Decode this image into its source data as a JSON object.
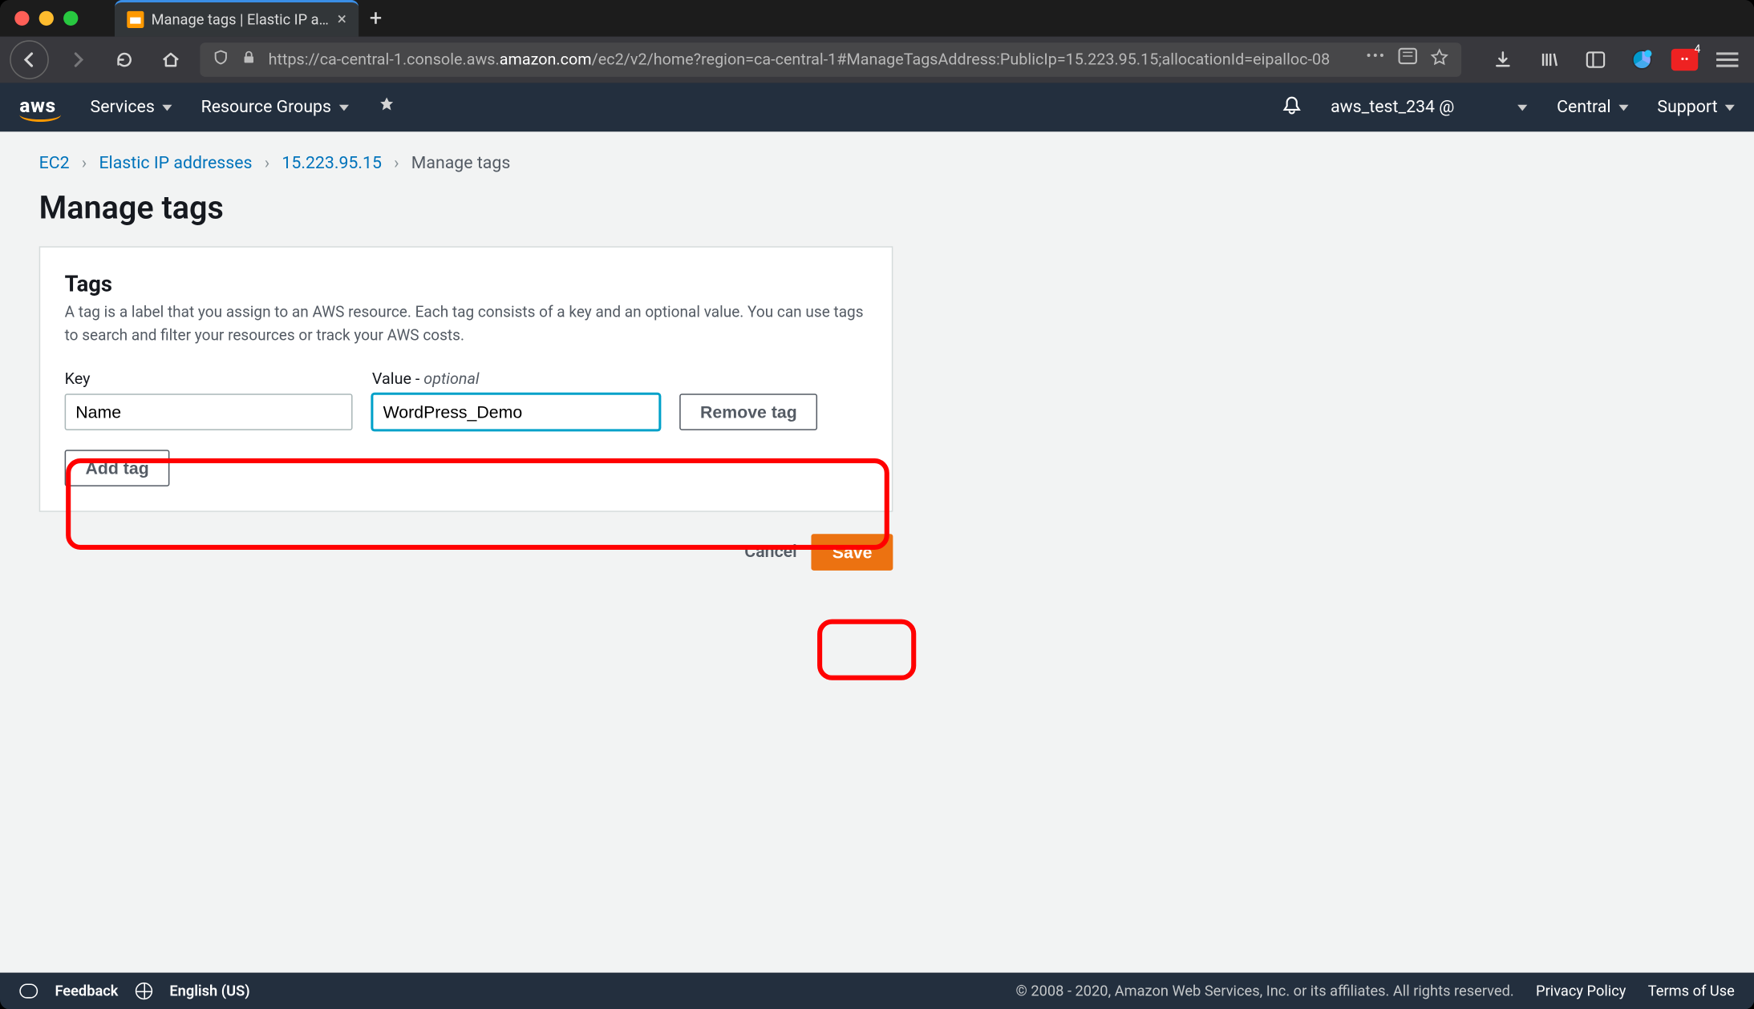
{
  "browser": {
    "tab_title": "Manage tags | Elastic IP addres",
    "url_prefix": "https://ca-central-1.console.aws.",
    "url_domain": "amazon.com",
    "url_suffix": "/ec2/v2/home?region=ca-central-1#ManageTagsAddress:PublicIp=15.223.95.15;allocationId=eipalloc-08",
    "badge_count": "4"
  },
  "header": {
    "services": "Services",
    "resource_groups": "Resource Groups",
    "account": "aws_test_234 @",
    "region": "Central",
    "support": "Support"
  },
  "breadcrumbs": {
    "ec2": "EC2",
    "eip": "Elastic IP addresses",
    "ip": "15.223.95.15",
    "current": "Manage tags"
  },
  "page": {
    "title": "Manage tags",
    "panel_title": "Tags",
    "panel_desc": "A tag is a label that you assign to an AWS resource. Each tag consists of a key and an optional value. You can use tags to search and filter your resources or track your AWS costs.",
    "key_label": "Key",
    "value_label_prefix": "Value - ",
    "value_label_opt": "optional",
    "remove_btn": "Remove tag",
    "add_btn": "Add tag",
    "cancel": "Cancel",
    "save": "Save",
    "tag_key": "Name",
    "tag_value": "WordPress_Demo"
  },
  "footer": {
    "feedback": "Feedback",
    "language": "English (US)",
    "copyright": "© 2008 - 2020, Amazon Web Services, Inc. or its affiliates. All rights reserved.",
    "privacy": "Privacy Policy",
    "terms": "Terms of Use"
  }
}
